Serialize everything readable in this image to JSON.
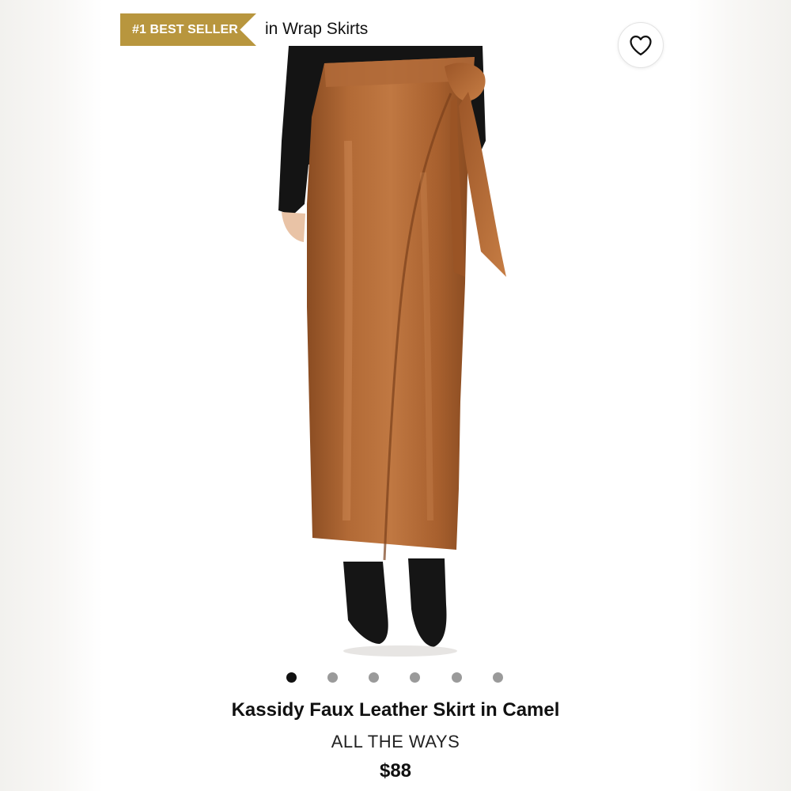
{
  "badge": {
    "rank_label": "#1 BEST SELLER",
    "category_text": "in Wrap Skirts",
    "color": "#b8963e"
  },
  "favorite": {
    "icon": "heart-outline-icon"
  },
  "product": {
    "title": "Kassidy Faux Leather Skirt in Camel",
    "brand": "ALL THE WAYS",
    "price": "$88",
    "color_swatch": "#a8602e"
  },
  "carousel": {
    "total": 6,
    "active_index": 0
  }
}
